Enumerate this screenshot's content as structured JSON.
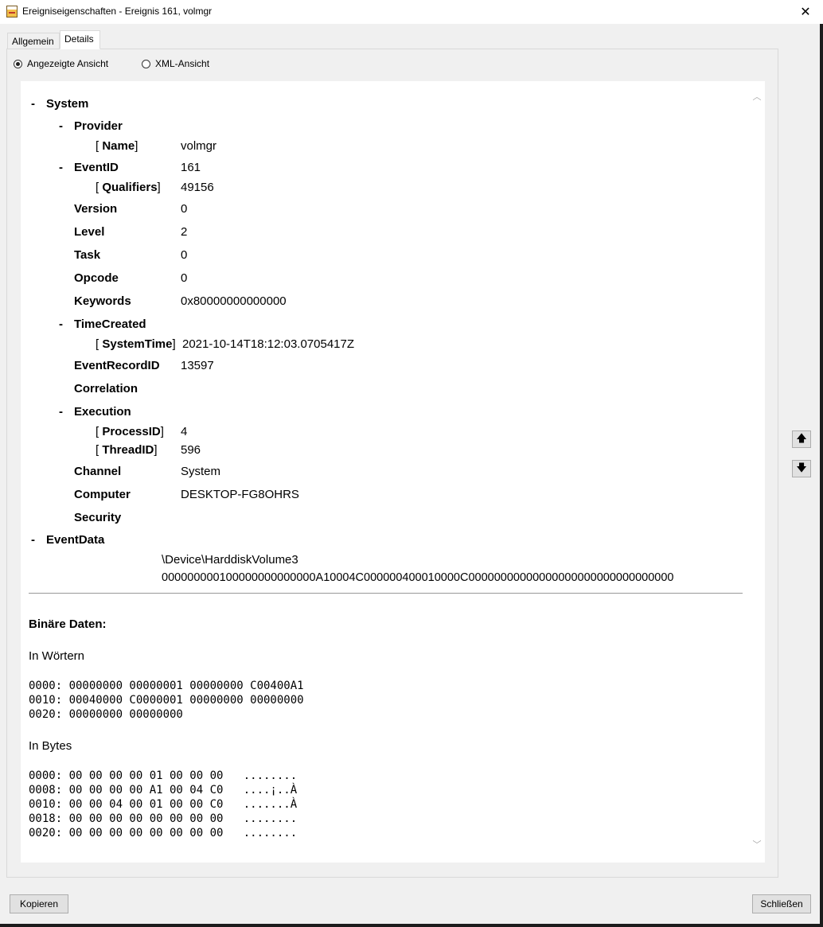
{
  "window": {
    "title": "Ereigniseigenschaften - Ereignis 161, volmgr",
    "close_glyph": "✕"
  },
  "tabs": [
    {
      "label": "Allgemein"
    },
    {
      "label": "Details"
    }
  ],
  "view_options": {
    "friendly": "Angezeigte Ansicht",
    "xml": "XML-Ansicht",
    "selected": "friendly"
  },
  "tree": {
    "system": "System",
    "provider": "Provider",
    "name_attr": "Name",
    "name_value": "volmgr",
    "eventid": "EventID",
    "eventid_value": "161",
    "qualifiers_attr": "Qualifiers",
    "qualifiers_value": "49156",
    "version": "Version",
    "version_value": "0",
    "level": "Level",
    "level_value": "2",
    "task": "Task",
    "task_value": "0",
    "opcode": "Opcode",
    "opcode_value": "0",
    "keywords": "Keywords",
    "keywords_value": "0x80000000000000",
    "timecreated": "TimeCreated",
    "systemtime_attr": "SystemTime",
    "systemtime_value": "2021-10-14T18:12:03.0705417Z",
    "eventrecordid": "EventRecordID",
    "eventrecordid_value": "13597",
    "correlation": "Correlation",
    "execution": "Execution",
    "processid_attr": "ProcessID",
    "processid_value": "4",
    "threadid_attr": "ThreadID",
    "threadid_value": "596",
    "channel": "Channel",
    "channel_value": "System",
    "computer": "Computer",
    "computer_value": "DESKTOP-FG8OHRS",
    "security": "Security",
    "eventdata": "EventData",
    "eventdata_line1": "\\Device\\HarddiskVolume3",
    "eventdata_line2": "000000000100000000000000A10004C000000400010000C00000000000000000000000000000000",
    "collapse_glyph": "-"
  },
  "binary": {
    "title": "Binäre Daten:",
    "words_label": "In Wörtern",
    "words": "0000: 00000000 00000001 00000000 C00400A1\n0010: 00040000 C0000001 00000000 00000000\n0020: 00000000 00000000",
    "bytes_label": "In Bytes",
    "bytes": "0000: 00 00 00 00 01 00 00 00   ........\n0008: 00 00 00 00 A1 00 04 C0   ....¡..À\n0010: 00 00 04 00 01 00 00 C0   .......À\n0018: 00 00 00 00 00 00 00 00   ........\n0020: 00 00 00 00 00 00 00 00   ........"
  },
  "buttons": {
    "copy": "Kopieren",
    "close": "Schließen",
    "prev_glyph": "🡅",
    "next_glyph": "🡇"
  },
  "scroll": {
    "up_glyph": "︿",
    "down_glyph": "﹀"
  }
}
